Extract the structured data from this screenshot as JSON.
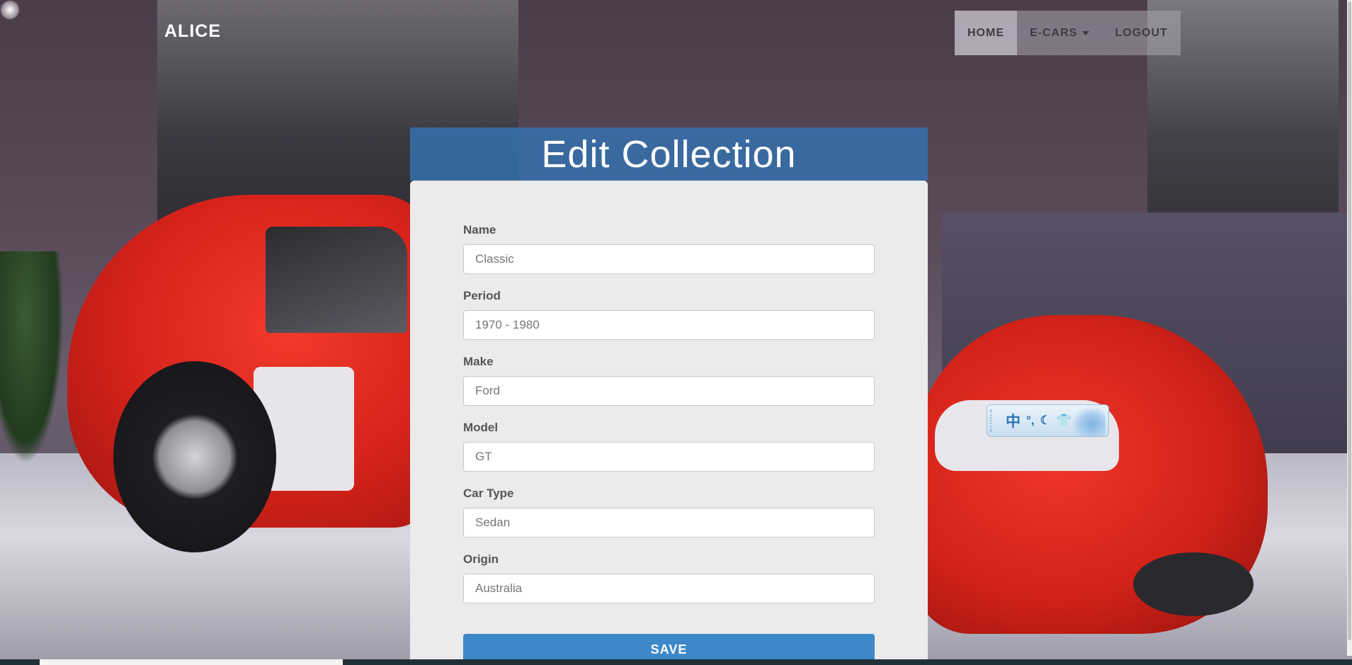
{
  "navbar": {
    "brand": "ALICE",
    "items": [
      {
        "label": "HOME",
        "active": true
      },
      {
        "label": "E-CARS",
        "dropdown": true
      },
      {
        "label": "LOGOUT"
      }
    ]
  },
  "form": {
    "title": "Edit Collection",
    "fields": [
      {
        "label": "Name",
        "value": "Classic"
      },
      {
        "label": "Period",
        "value": "1970 - 1980"
      },
      {
        "label": "Make",
        "value": "Ford"
      },
      {
        "label": "Model",
        "value": "GT"
      },
      {
        "label": "Car Type",
        "value": "Sedan"
      },
      {
        "label": "Origin",
        "value": "Australia"
      }
    ],
    "save_label": "SAVE"
  },
  "ime_toolbar": {
    "mode": "中",
    "icons": [
      "punctuation-icon",
      "moon-icon",
      "shirt-icon",
      "flower-skin-icon"
    ]
  },
  "colors": {
    "header_blue": "#356eaa",
    "save_blue": "#3d88c9",
    "panel_gray": "#ebebec"
  }
}
